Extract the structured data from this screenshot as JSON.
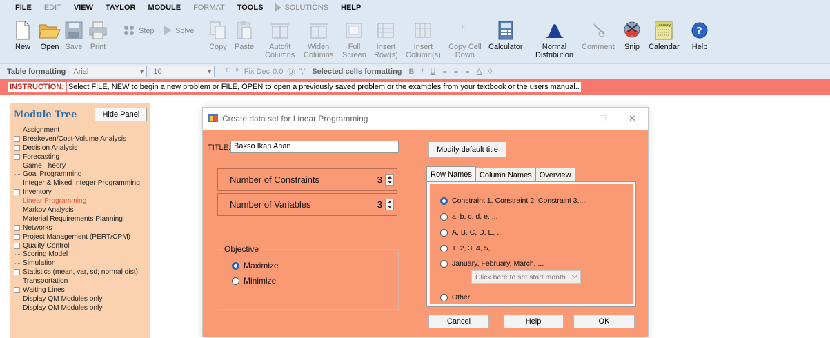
{
  "menu": {
    "file": "FILE",
    "edit": "EDIT",
    "view": "VIEW",
    "taylor": "TAYLOR",
    "module": "MODULE",
    "format": "FORMAT",
    "tools": "TOOLS",
    "solutions": "SOLUTIONS",
    "help": "HELP"
  },
  "toolbar": {
    "new": "New",
    "open": "Open",
    "save": "Save",
    "print": "Print",
    "step": "Step",
    "solve": "Solve",
    "copy": "Copy",
    "paste": "Paste",
    "autofit_1": "Autofit",
    "autofit_2": "Columns",
    "widen_1": "Widen",
    "widen_2": "Columns",
    "full_1": "Full",
    "full_2": "Screen",
    "insert_row_1": "Insert",
    "insert_row_2": "Row(s)",
    "insert_col_1": "Insert",
    "insert_col_2": "Column(s)",
    "copy_cell_1": "Copy Cell",
    "copy_cell_2": "Down",
    "calculator": "Calculator",
    "normal_1": "Normal",
    "normal_2": "Distribution",
    "comment": "Comment",
    "snip": "Snip",
    "calendar": "Calendar",
    "help": "Help",
    "calendar_icon_text": "January"
  },
  "formatbar": {
    "table_formatting": "Table formatting",
    "font": "Arial",
    "size": "10",
    "fixdec": "Fix Dec",
    "fixdec_value": "0.0",
    "selected_cells": "Selected cells formatting",
    "bold": "B",
    "italic": "I",
    "underline": "U",
    "color_a": "A"
  },
  "instruction": {
    "label": "INSTRUCTION:",
    "text": "Select FILE, NEW to begin a new problem or FILE, OPEN to open a previously saved problem or the examples from your textbook or the users manual.."
  },
  "panel": {
    "title": "Module Tree",
    "hide_button": "Hide Panel",
    "items": [
      {
        "label": "Assignment",
        "expandable": false
      },
      {
        "label": "Breakeven/Cost-Volume Analysis",
        "expandable": true
      },
      {
        "label": "Decision Analysis",
        "expandable": true
      },
      {
        "label": "Forecasting",
        "expandable": true
      },
      {
        "label": "Game Theory",
        "expandable": false
      },
      {
        "label": "Goal Programming",
        "expandable": false
      },
      {
        "label": "Integer & Mixed Integer Programming",
        "expandable": false
      },
      {
        "label": "Inventory",
        "expandable": true
      },
      {
        "label": "Linear Programming",
        "expandable": false,
        "selected": true
      },
      {
        "label": "Markov Analysis",
        "expandable": false
      },
      {
        "label": "Material Requirements Planning",
        "expandable": false
      },
      {
        "label": "Networks",
        "expandable": true
      },
      {
        "label": "Project Management (PERT/CPM)",
        "expandable": true
      },
      {
        "label": "Quality Control",
        "expandable": true
      },
      {
        "label": "Scoring Model",
        "expandable": false
      },
      {
        "label": "Simulation",
        "expandable": false
      },
      {
        "label": "Statistics (mean, var, sd; normal dist)",
        "expandable": true
      },
      {
        "label": "Transportation",
        "expandable": false
      },
      {
        "label": "Waiting Lines",
        "expandable": true
      },
      {
        "label": "Display QM Modules only",
        "expandable": false
      },
      {
        "label": "Display OM Modules only",
        "expandable": false
      }
    ]
  },
  "dialog": {
    "title": "Create data set for Linear Programming",
    "title_label": "TITLE:",
    "title_value": "Bakso Ikan Ahan",
    "modify_title_button": "Modify default title",
    "constraints_label": "Number of Constraints",
    "constraints_value": "3",
    "variables_label": "Number of Variables",
    "variables_value": "3",
    "objective_label": "Objective",
    "maximize": "Maximize",
    "minimize": "Minimize",
    "tabs": [
      "Row Names",
      "Column Names",
      "Overview"
    ],
    "row_options": [
      "Constraint 1, Constraint 2, Constraint 3,...",
      "a, b, c, d, e, ...",
      "A, B, C, D, E, ...",
      "1, 2, 3, 4, 5, ...",
      "January, February, March, ..."
    ],
    "month_placeholder": "Click here to set start month",
    "other_option": "Other",
    "cancel": "Cancel",
    "help": "Help",
    "ok": "OK"
  },
  "colors": {
    "instruction_bar": "#f7786e",
    "dialog_bg": "#fa9a75",
    "panel_bg": "#fbd2b0",
    "radio_accent": "#2a62b4"
  }
}
